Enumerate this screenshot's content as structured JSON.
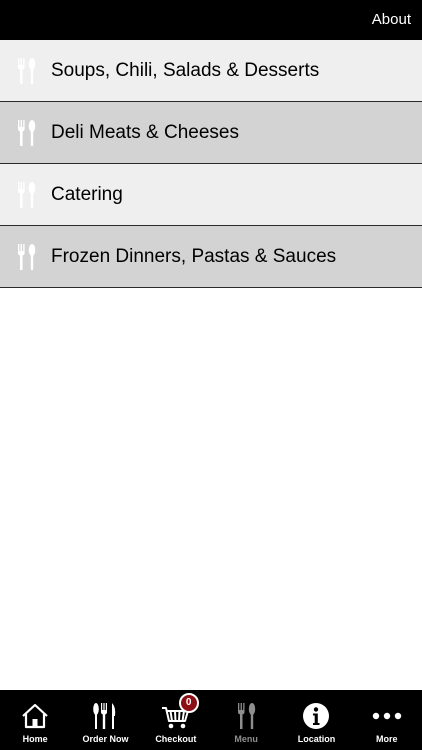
{
  "header": {
    "about_label": "About"
  },
  "menu": {
    "items": [
      {
        "label": "Soups, Chili, Salads & Desserts",
        "icon": "fork-knife-icon"
      },
      {
        "label": "Deli Meats & Cheeses",
        "icon": "fork-knife-icon"
      },
      {
        "label": "Catering",
        "icon": "fork-knife-icon"
      },
      {
        "label": "Frozen Dinners, Pastas & Sauces",
        "icon": "fork-knife-icon"
      }
    ]
  },
  "tabbar": {
    "tabs": [
      {
        "label": "Home",
        "icon": "home-icon"
      },
      {
        "label": "Order Now",
        "icon": "utensils-icon"
      },
      {
        "label": "Checkout",
        "icon": "cart-icon",
        "badge": "0"
      },
      {
        "label": "Menu",
        "icon": "fork-knife-icon",
        "active": true
      },
      {
        "label": "Location",
        "icon": "info-icon"
      },
      {
        "label": "More",
        "icon": "more-icon"
      }
    ]
  },
  "colors": {
    "bar_background": "#000000",
    "row_light": "#efefef",
    "row_dark": "#d3d3d3",
    "badge": "#8b0f15",
    "active_tab_text": "#8e8e8e"
  }
}
